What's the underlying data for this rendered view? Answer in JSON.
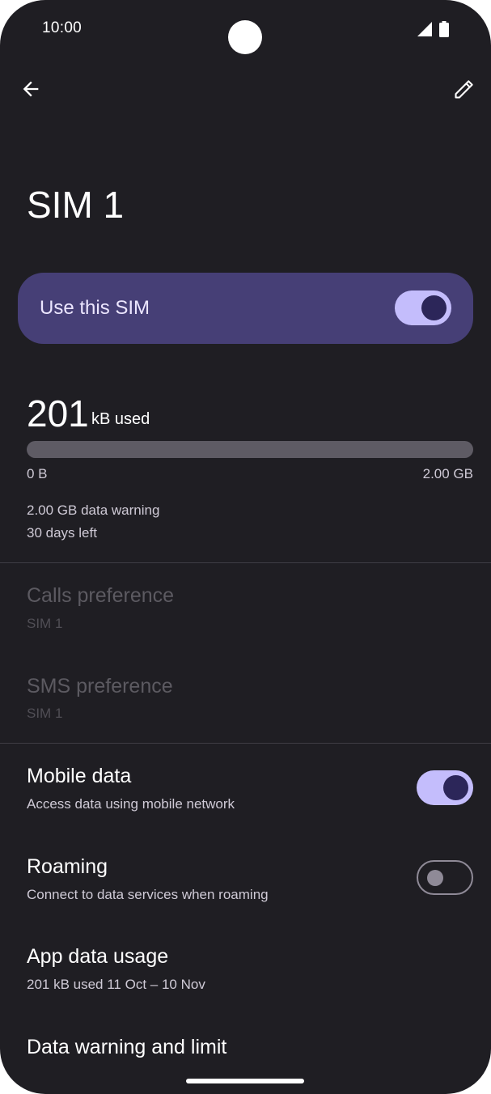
{
  "status_bar": {
    "time": "10:00",
    "icons": [
      "signal-icon",
      "battery-icon"
    ]
  },
  "toolbar": {
    "back_icon": "arrow-back-icon",
    "edit_icon": "pencil-icon"
  },
  "page": {
    "title": "SIM 1"
  },
  "use_sim": {
    "label": "Use this SIM",
    "enabled": true
  },
  "usage": {
    "amount": "201",
    "unit": "kB used",
    "bar_min": "0 B",
    "bar_max": "2.00 GB",
    "fill_fraction": 0.0001,
    "warning": "2.00 GB data warning",
    "days_left": "30 days left"
  },
  "preferences": {
    "calls": {
      "title": "Calls preference",
      "value": "SIM 1"
    },
    "sms": {
      "title": "SMS preference",
      "value": "SIM 1"
    }
  },
  "settings": {
    "mobile_data": {
      "title": "Mobile data",
      "subtitle": "Access data using mobile network",
      "enabled": true
    },
    "roaming": {
      "title": "Roaming",
      "subtitle": "Connect to data services when roaming",
      "enabled": false
    },
    "app_data_usage": {
      "title": "App data usage",
      "subtitle": "201 kB used 11 Oct – 10 Nov"
    },
    "data_warning": {
      "title": "Data warning and limit"
    }
  },
  "colors": {
    "background": "#1f1e23",
    "card": "#463f76",
    "toggle_on_track": "#c4bdfc",
    "toggle_on_knob": "#2c2659"
  }
}
